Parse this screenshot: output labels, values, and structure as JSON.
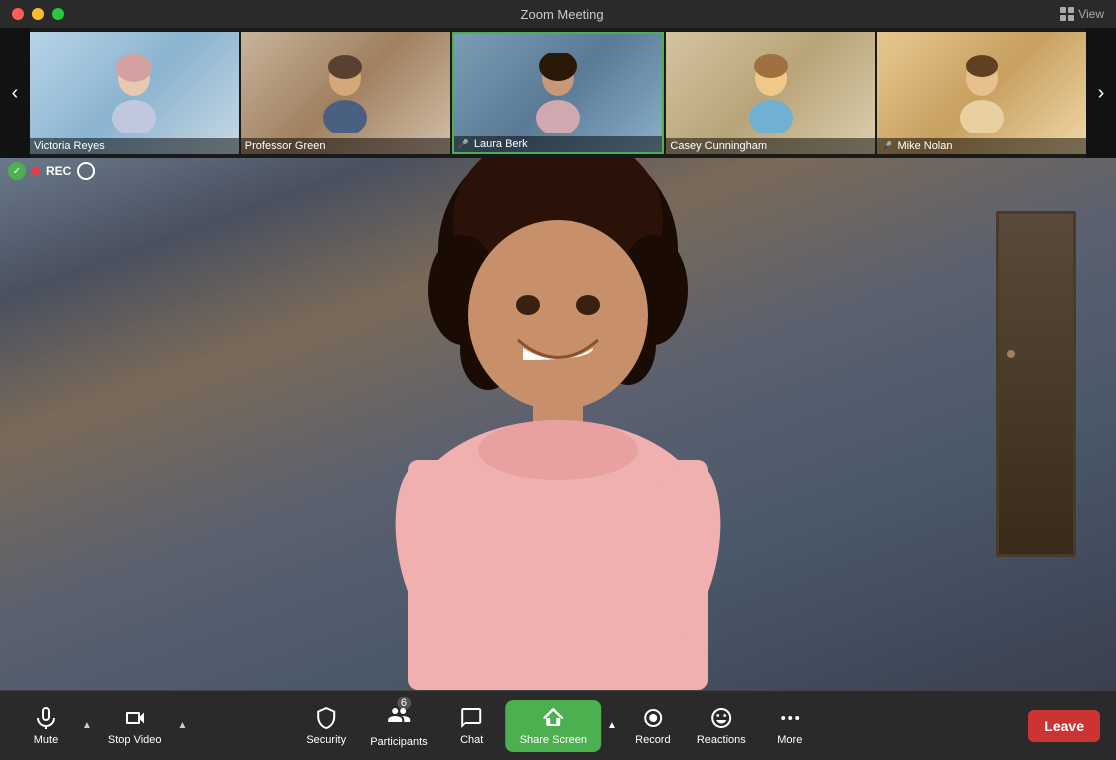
{
  "titleBar": {
    "title": "Zoom Meeting",
    "viewLabel": "View",
    "trafficLights": [
      "close",
      "minimize",
      "maximize"
    ]
  },
  "thumbnails": {
    "prevArrow": "‹",
    "nextArrow": "›",
    "participants": [
      {
        "id": "victoria",
        "name": "Victoria Reyes",
        "cssClass": "thumb-victoria",
        "active": false,
        "micMuted": false
      },
      {
        "id": "professor",
        "name": "Professor Green",
        "cssClass": "thumb-professor",
        "active": false,
        "micMuted": false
      },
      {
        "id": "laura",
        "name": "Laura Berk",
        "cssClass": "thumb-laura",
        "active": true,
        "micMuted": true,
        "micIcon": "🎤"
      },
      {
        "id": "casey",
        "name": "Casey Cunningham",
        "cssClass": "thumb-casey",
        "active": false,
        "micMuted": false
      },
      {
        "id": "mike",
        "name": "Mike Nolan",
        "cssClass": "thumb-mike",
        "active": false,
        "micMuted": true,
        "micIcon": "🎤"
      }
    ]
  },
  "recordingBadge": {
    "recLabel": "REC"
  },
  "mainVideo": {
    "participantName": "Laura Berk"
  },
  "toolbar": {
    "mute": {
      "label": "Mute",
      "hasArrow": true
    },
    "stopVideo": {
      "label": "Stop Video",
      "hasArrow": true
    },
    "security": {
      "label": "Security"
    },
    "participants": {
      "label": "Participants",
      "count": "6",
      "hasArrow": false
    },
    "chat": {
      "label": "Chat"
    },
    "shareScreen": {
      "label": "Share Screen",
      "hasArrow": true
    },
    "record": {
      "label": "Record"
    },
    "reactions": {
      "label": "Reactions"
    },
    "more": {
      "label": "More"
    },
    "leave": {
      "label": "Leave"
    }
  }
}
